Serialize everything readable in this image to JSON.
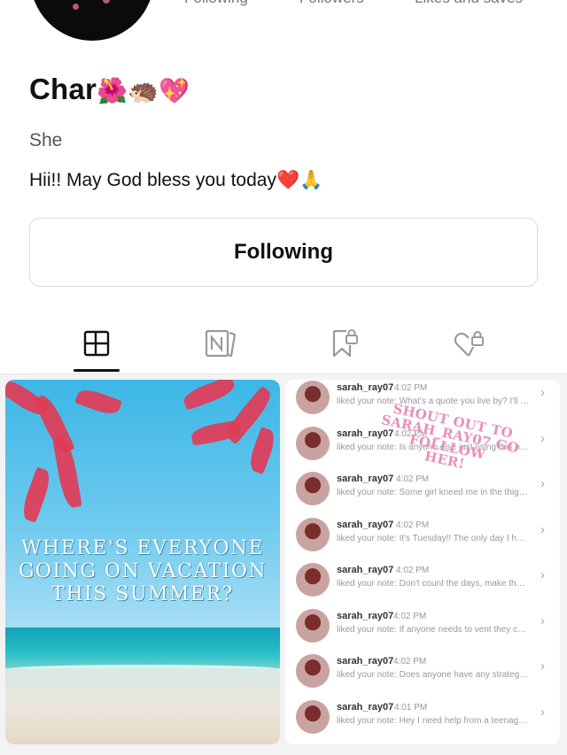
{
  "header": {
    "stats": [
      "Following",
      "Followers",
      "Likes and saves"
    ]
  },
  "profile": {
    "name": "Char",
    "name_emoji": "🌺🦔💖",
    "pronoun": "She",
    "bio": "Hii!! May God bless you today❤️🙏"
  },
  "follow_button": {
    "label": "Following"
  },
  "tabs": [
    {
      "name": "posts",
      "icon": "grid-layout-icon",
      "active": true
    },
    {
      "name": "notes",
      "icon": "notes-icon",
      "active": false
    },
    {
      "name": "saved",
      "icon": "bookmark-lock-icon",
      "active": false
    },
    {
      "name": "liked",
      "icon": "heart-lock-icon",
      "active": false
    }
  ],
  "post_left": {
    "caption": "WHERE'S EVERYONE\nGOING ON VACATION\nTHIS SUMMER?"
  },
  "post_right": {
    "overlay": "SHOUT OUT TO\nSARAH_RAY07 GO FOLLLOW\nHER!",
    "notifications": [
      {
        "user": "sarah_ray07",
        "time": "4:02 PM",
        "message": "liked your note: What's a quote you live by? I'll go..."
      },
      {
        "user": "sarah_ray07",
        "time": "4:02 PM",
        "message": "liked your note: Is anyone else just using this not..."
      },
      {
        "user": "sarah_ray07",
        "time": "4:02 PM",
        "message": "liked your note: Some girl kneed me in the thigh a..."
      },
      {
        "user": "sarah_ray07",
        "time": "4:02 PM",
        "message": "liked your note: It's Tuesday!! The only day I have ..."
      },
      {
        "user": "sarah_ray07",
        "time": "4:02 PM",
        "message": "liked your note: Don't count the days, make the da..."
      },
      {
        "user": "sarah_ray07",
        "time": "4:02 PM",
        "message": "liked your note: If anyone needs to vent they can j..."
      },
      {
        "user": "sarah_ray07",
        "time": "4:02 PM",
        "message": "liked your note: Does anyone have any strategies..."
      },
      {
        "user": "sarah_ray07",
        "time": "4:01 PM",
        "message": "liked your note: Hey I need help from a teenage gi..."
      }
    ]
  },
  "colors": {
    "tab_active": "#111111",
    "tab_inactive": "#9a9a9a",
    "overlay_pink": "#e98fbb"
  }
}
